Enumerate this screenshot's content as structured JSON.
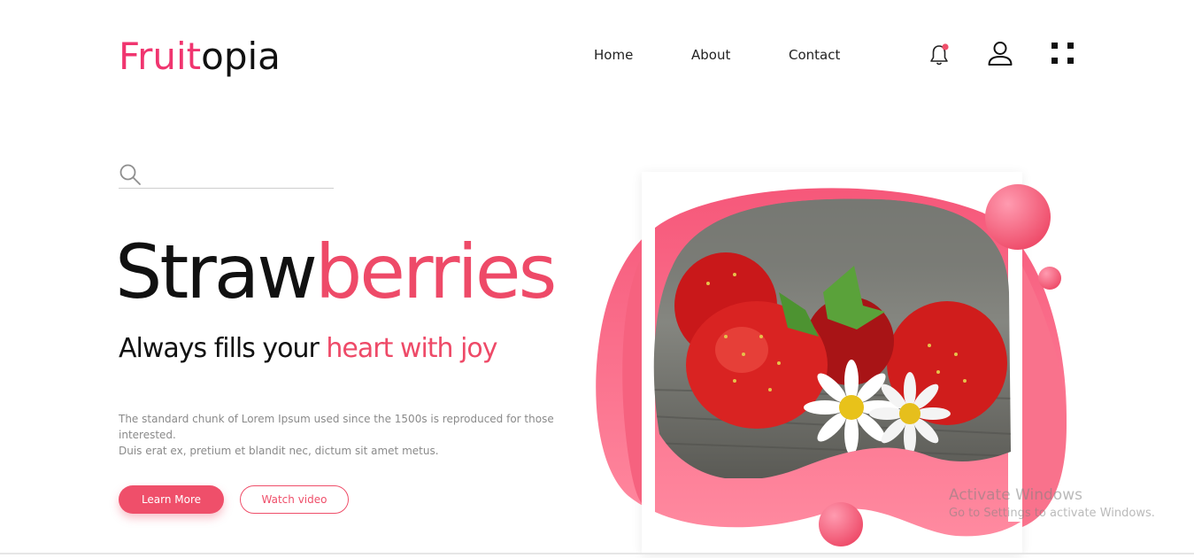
{
  "brand": {
    "part1": "Fruit",
    "part2": "opia"
  },
  "nav": {
    "home": "Home",
    "about": "About",
    "contact": "Contact"
  },
  "search": {
    "placeholder": ""
  },
  "hero": {
    "title_dark": "Straw",
    "title_pink": "berries",
    "subtitle_dark": "Always fills your ",
    "subtitle_pink": "heart with joy",
    "description_line1": "The standard chunk of Lorem Ipsum used since the 1500s is reproduced for those interested.",
    "description_line2": "Duis erat ex, pretium et blandit nec, dictum sit amet metus.",
    "primary_button": "Learn More",
    "secondary_button": "Watch video"
  },
  "watermark": {
    "line1": "Activate Windows",
    "line2": "Go to Settings to activate Windows."
  },
  "icons": [
    "bell-icon",
    "user-icon",
    "grid-icon",
    "search-icon"
  ],
  "colors": {
    "accent": "#ef4f6a",
    "logo_pink": "#f0356f",
    "text": "#111111"
  }
}
